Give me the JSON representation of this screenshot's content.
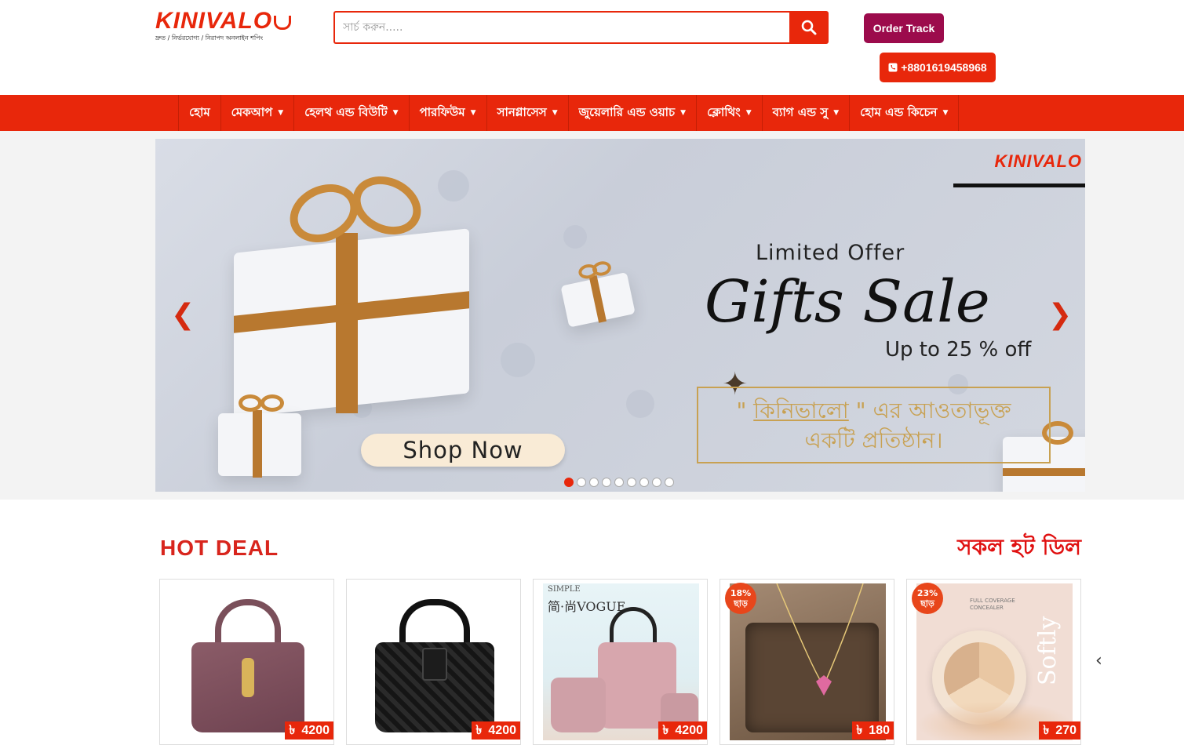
{
  "brand": {
    "name": "KINIVALO",
    "tagline": "দ্রুত / নির্ভরযোগ্য / নিরাপদ অনলাইন শপিং"
  },
  "search": {
    "placeholder": "সার্চ করুন....."
  },
  "header": {
    "order_track_label": "Order Track",
    "phone_label": "+8801619458968"
  },
  "nav": {
    "items": [
      {
        "label": "হোম",
        "has_dropdown": false
      },
      {
        "label": "মেকআপ",
        "has_dropdown": true
      },
      {
        "label": "হেলথ এন্ড বিউটি",
        "has_dropdown": true
      },
      {
        "label": "পারফিউম",
        "has_dropdown": true
      },
      {
        "label": "সানগ্লাসেস",
        "has_dropdown": true
      },
      {
        "label": "জুয়েলারি এন্ড ওয়াচ",
        "has_dropdown": true
      },
      {
        "label": "ক্লোথিং",
        "has_dropdown": true
      },
      {
        "label": "ব্যাগ এন্ড সু",
        "has_dropdown": true
      },
      {
        "label": "হোম এন্ড কিচেন",
        "has_dropdown": true
      }
    ]
  },
  "slider": {
    "brand": "KINIVALO",
    "offer_small": "Limited Offer",
    "offer_big": "Gifts Sale",
    "offer_pct": "Up to 25 % off",
    "bn_line1_pre": "\" ",
    "bn_line1_link": "কিনিভালো",
    "bn_line1_post": " \" এর আওতাভূক্ত",
    "bn_line2": "একটি প্রতিষ্ঠান।",
    "shop_now": "Shop Now",
    "dot_count": 9,
    "active_dot": 0
  },
  "hot_deal": {
    "title": "HOT DEAL",
    "all_link": "সকল হট ডিল",
    "products": [
      {
        "price": "4200",
        "currency": "৳",
        "discount": null,
        "kind": "bag-purple"
      },
      {
        "price": "4200",
        "currency": "৳",
        "discount": null,
        "kind": "bag-black"
      },
      {
        "price": "4200",
        "currency": "৳",
        "discount": null,
        "kind": "bag-pink",
        "img_text_top": "SIMPLE",
        "img_text_big": "简·尚VOGUE"
      },
      {
        "price": "180",
        "currency": "৳",
        "discount": {
          "pct": "18%",
          "label": "ছাড়"
        },
        "kind": "necklace"
      },
      {
        "price": "270",
        "currency": "৳",
        "discount": {
          "pct": "23%",
          "label": "ছাড়"
        },
        "kind": "concealer",
        "img_text_top": "FULL COVERAGE CONCEALER",
        "img_text_side": "Softly"
      }
    ]
  },
  "colors": {
    "accent": "#e8270b",
    "order_track": "#9c0b4c",
    "hot_title": "#d8251d"
  }
}
